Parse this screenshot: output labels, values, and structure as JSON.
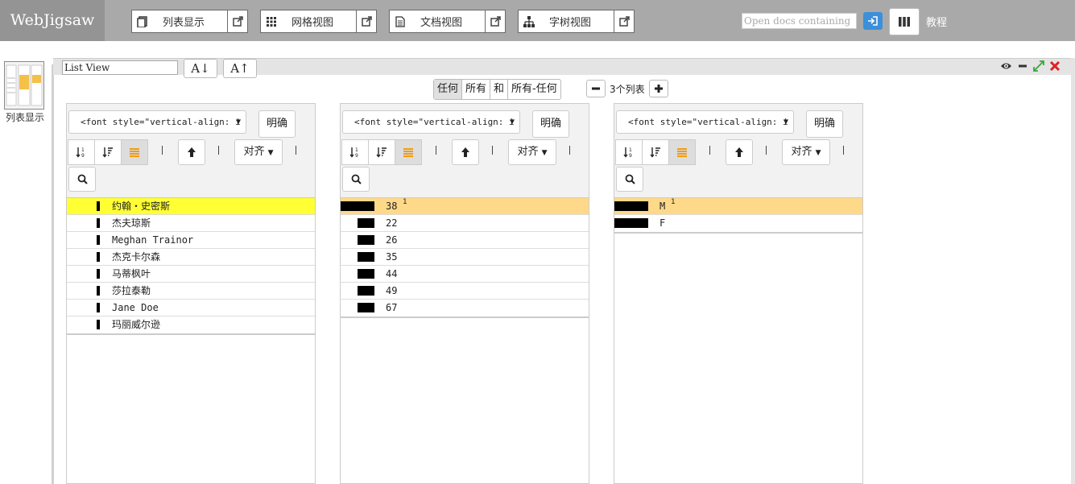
{
  "brand": "WebJigsaw",
  "nav": [
    {
      "label": "列表显示",
      "icon": "list-icon"
    },
    {
      "label": "网格视图",
      "icon": "grid-icon"
    },
    {
      "label": "文档视图",
      "icon": "document-icon"
    },
    {
      "label": "字树视图",
      "icon": "tree-icon"
    }
  ],
  "search": {
    "placeholder": "Open docs containing"
  },
  "tutorial": "教程",
  "thumbnail_label": "列表显示",
  "panel": {
    "view_name": "List View",
    "font_down": "A↓",
    "font_up": "A↑",
    "modes": [
      "任何",
      "所有",
      "和",
      "所有-任何"
    ],
    "active_mode": "任何",
    "list_count": "3个列表"
  },
  "columns": [
    {
      "select_text": "<font style=\"vertical-align: i",
      "clear_label": "明确",
      "align_label": "对齐",
      "bar_offset": "indent",
      "rows": [
        {
          "text": "约翰・史密斯",
          "bar": 0.07,
          "highlight": "yellow",
          "count": ""
        },
        {
          "text": "杰夫琼斯",
          "bar": 0.07,
          "highlight": "",
          "count": ""
        },
        {
          "text": "Meghan Trainor",
          "bar": 0.07,
          "highlight": "",
          "count": ""
        },
        {
          "text": "杰克卡尔森",
          "bar": 0.07,
          "highlight": "",
          "count": ""
        },
        {
          "text": "马蒂枫叶",
          "bar": 0.07,
          "highlight": "",
          "count": ""
        },
        {
          "text": "莎拉泰勒",
          "bar": 0.07,
          "highlight": "",
          "count": ""
        },
        {
          "text": "Jane Doe",
          "bar": 0.07,
          "highlight": "",
          "count": ""
        },
        {
          "text": "玛丽威尔逊",
          "bar": 0.07,
          "highlight": "",
          "count": ""
        }
      ]
    },
    {
      "select_text": "<font style=\"vertical-align: i",
      "clear_label": "明确",
      "align_label": "对齐",
      "rows": [
        {
          "text": "38",
          "bar": 1.0,
          "highlight": "orange",
          "count": "1"
        },
        {
          "text": "22",
          "bar": 0.5,
          "highlight": "",
          "count": ""
        },
        {
          "text": "26",
          "bar": 0.5,
          "highlight": "",
          "count": ""
        },
        {
          "text": "35",
          "bar": 0.5,
          "highlight": "",
          "count": ""
        },
        {
          "text": "44",
          "bar": 0.5,
          "highlight": "",
          "count": ""
        },
        {
          "text": "49",
          "bar": 0.5,
          "highlight": "",
          "count": ""
        },
        {
          "text": "67",
          "bar": 0.5,
          "highlight": "",
          "count": ""
        }
      ]
    },
    {
      "select_text": "<font style=\"vertical-align: i",
      "clear_label": "明确",
      "align_label": "对齐",
      "rows": [
        {
          "text": "M",
          "bar": 1.0,
          "highlight": "orange",
          "count": "1"
        },
        {
          "text": "F",
          "bar": 1.0,
          "highlight": "",
          "count": ""
        }
      ]
    }
  ],
  "colors": {
    "topbar": "#a9a9a9",
    "brand_bg": "#949494",
    "go_button": "#3c8fd9",
    "yellow_highlight": "#ffff33",
    "orange_highlight": "#ffd98a",
    "sort_active": "#f39c12",
    "close_red": "#e02020",
    "resize_green": "#3aa63a"
  }
}
